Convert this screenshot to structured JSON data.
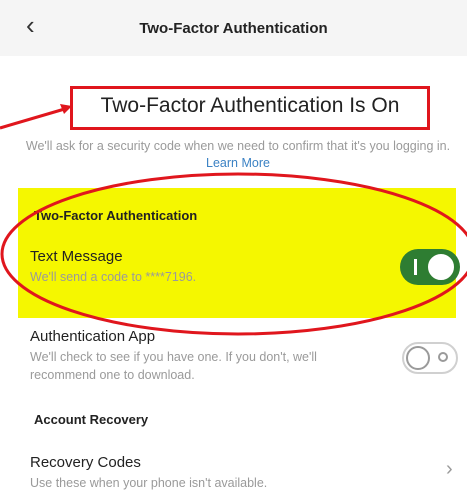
{
  "header": {
    "title": "Two-Factor Authentication",
    "back_icon": "chevron-left-icon"
  },
  "hero": {
    "title": "Two-Factor Authentication Is On",
    "description": "We'll ask for a security code when we need to confirm that it's you logging in.",
    "learn_more": "Learn More"
  },
  "two_factor_section": {
    "heading": "Two-Factor Authentication",
    "text_message": {
      "title": "Text Message",
      "description": "We'll send a code to ****7196.",
      "enabled": true
    },
    "auth_app": {
      "title": "Authentication App",
      "description": "We'll check to see if you have one. If you don't, we'll recommend one to download.",
      "enabled": false
    }
  },
  "account_recovery": {
    "heading": "Account Recovery",
    "recovery_codes": {
      "title": "Recovery Codes",
      "description": "Use these when your phone isn't available."
    }
  },
  "colors": {
    "highlight": "#f5f700",
    "annotation": "#e0161d",
    "toggle_on": "#2e7d32",
    "link": "#3b82c4"
  }
}
